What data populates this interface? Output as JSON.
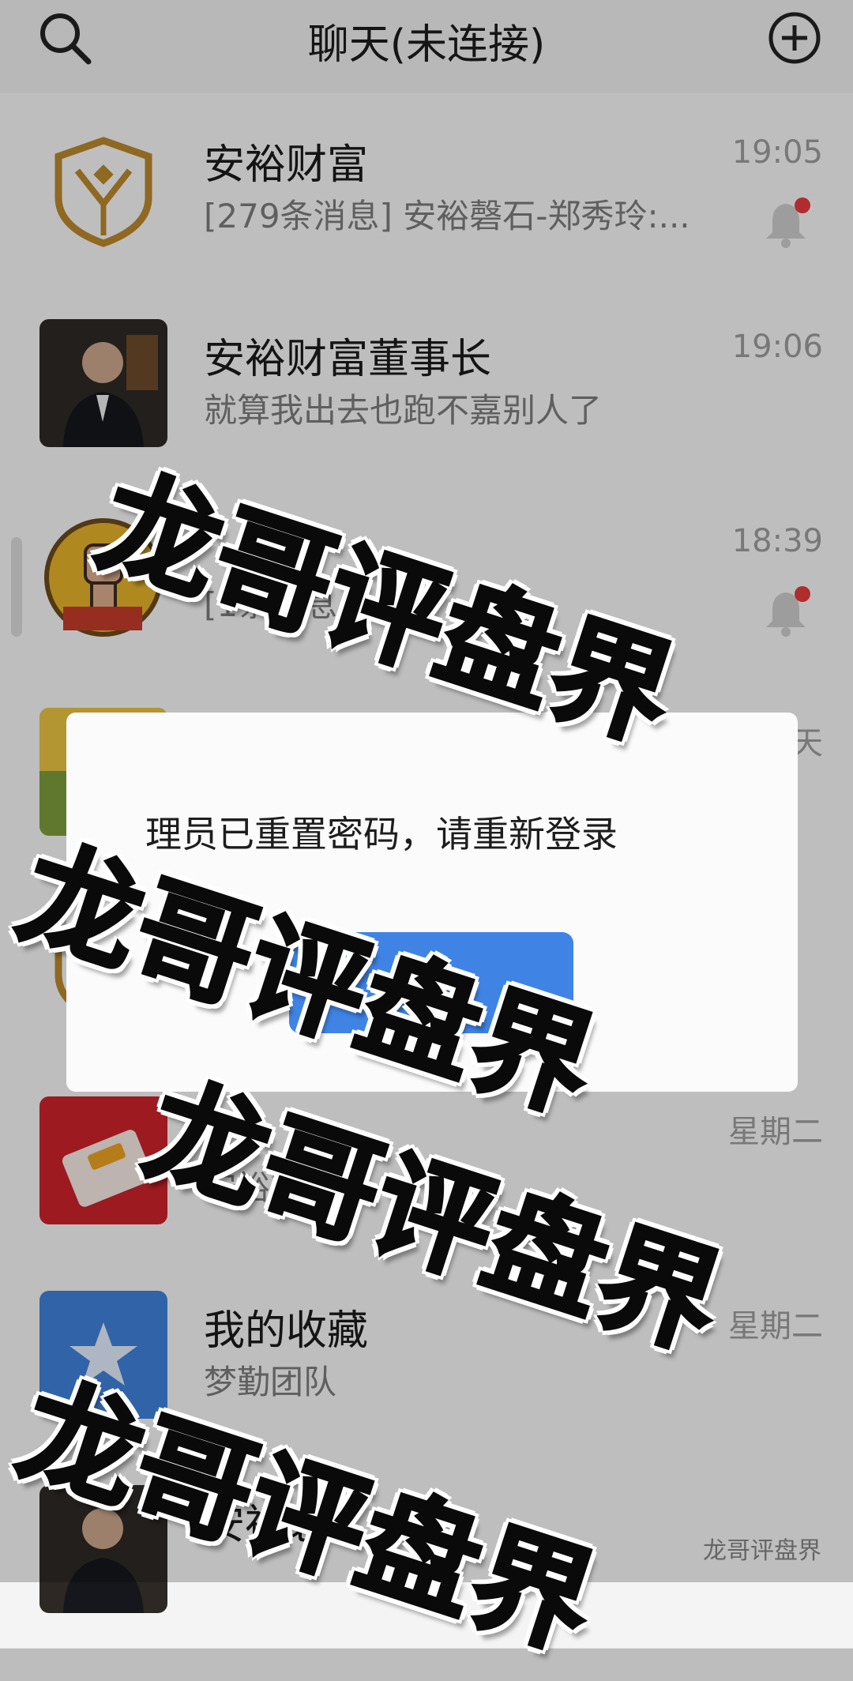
{
  "header": {
    "title": "聊天(未连接)",
    "search_icon": "search-icon",
    "add_icon": "plus-circle-icon"
  },
  "chats": [
    {
      "name": "安裕财富",
      "preview": "[279条消息] 安裕磬石-郑秀玲:...",
      "time": "19:05",
      "muted": true,
      "unread": true
    },
    {
      "name": "安裕财富董事长",
      "preview": "就算我出去也跑不嘉别人了",
      "time": "19:06",
      "muted": false,
      "unread": false
    },
    {
      "name": "",
      "preview": "[1条消息",
      "time": "18:39",
      "muted": true,
      "unread": true
    },
    {
      "name": "",
      "preview": "",
      "time": "天",
      "muted": false,
      "unread": false
    },
    {
      "name": "",
      "preview": "",
      "time": "",
      "muted": false,
      "unread": false
    },
    {
      "name": "",
      "preview": "安裕财富董",
      "time": "星期二",
      "muted": false,
      "unread": false
    },
    {
      "name": "我的收藏",
      "preview": "梦勤团队",
      "time": "星期二",
      "muted": false,
      "unread": false
    },
    {
      "name": "安裕必",
      "preview": "",
      "time": "",
      "muted": false,
      "unread": false
    }
  ],
  "dialog": {
    "message": "理员已重置密码，请重新登录",
    "ok_label": "确"
  },
  "watermark": {
    "text": "龙哥评盘界",
    "footer": "龙哥评盘界"
  },
  "colors": {
    "accent": "#3f84e5",
    "unread_dot": "#e23a3a",
    "logo_gold": "#b8862b"
  }
}
